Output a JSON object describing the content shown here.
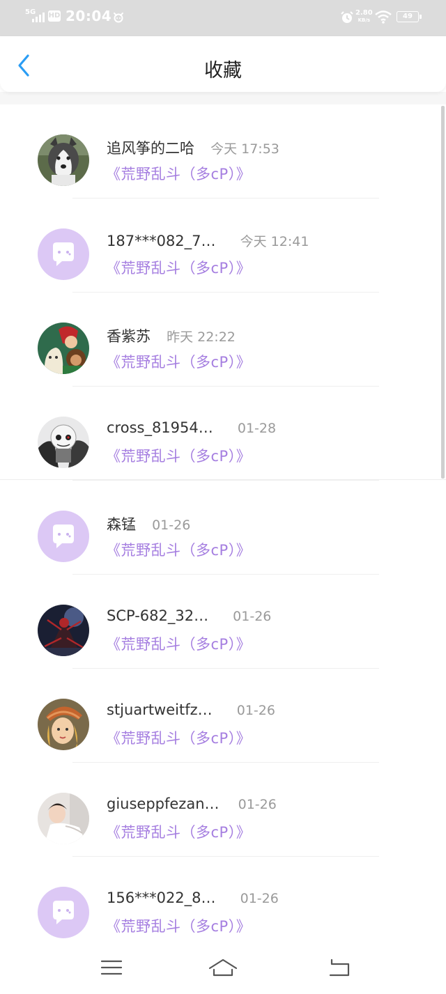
{
  "status_bar": {
    "network": "5G",
    "hd": "HD",
    "time": "20:04",
    "speed_value": "2.80",
    "speed_unit": "KB/s",
    "battery": "49"
  },
  "header": {
    "title": "收藏"
  },
  "items": [
    {
      "name": "追风筝的二哈",
      "time": "今天 17:53",
      "group": "《荒野乱斗（多cP）》",
      "avatar": "husky-photo"
    },
    {
      "name": "187***082_7…",
      "time": "今天 12:41",
      "group": "《荒野乱斗（多cP）》",
      "avatar": "default-chat-avatar"
    },
    {
      "name": "香紫苏",
      "time": "昨天 22:22",
      "group": "《荒野乱斗（多cP）》",
      "avatar": "cartoon-characters"
    },
    {
      "name": "cross_81954…",
      "time": "01-28",
      "group": "《荒野乱斗（多cP）》",
      "avatar": "skeleton-cartoon"
    },
    {
      "name": "森锰",
      "time": "01-26",
      "group": "《荒野乱斗（多cP）》",
      "avatar": "default-chat-avatar"
    },
    {
      "name": "SCP-682_32…",
      "time": "01-26",
      "group": "《荒野乱斗（多cP）》",
      "avatar": "spider-figure-dark"
    },
    {
      "name": "stjuartweitfz…",
      "time": "01-26",
      "group": "《荒野乱斗（多cP）》",
      "avatar": "girl-with-hat"
    },
    {
      "name": "giuseppfezan…",
      "time": "01-26",
      "group": "《荒野乱斗（多cP）》",
      "avatar": "girl-white-dress"
    },
    {
      "name": "156***022_8…",
      "time": "01-26",
      "group": "《荒野乱斗（多cP）》",
      "avatar": "default-chat-avatar"
    }
  ],
  "colors": {
    "accent_blue": "#2a9df4",
    "group_purple": "#a57ee0",
    "default_avatar_bg": "#dcc8f5"
  },
  "bottom_nav": {
    "menu_icon": "menu-icon",
    "home_icon": "home-icon",
    "back_icon": "return-icon"
  }
}
